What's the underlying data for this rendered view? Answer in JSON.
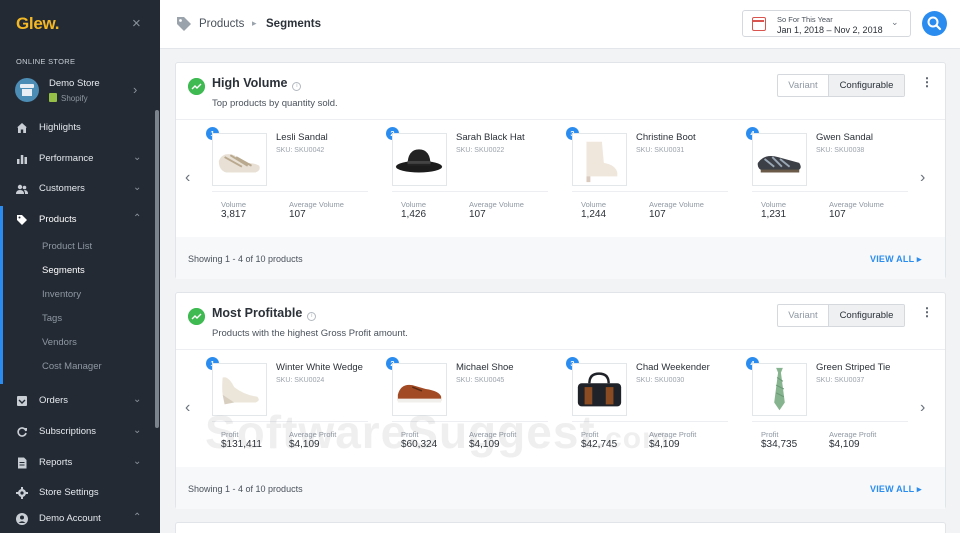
{
  "sidebar": {
    "logo": "Glew.",
    "close": "×",
    "section_label": "ONLINE STORE",
    "store": {
      "name": "Demo Store",
      "platform": "Shopify"
    },
    "items": [
      {
        "label": "Highlights",
        "icon": "home-icon"
      },
      {
        "label": "Performance",
        "icon": "bar-chart-icon"
      },
      {
        "label": "Customers",
        "icon": "users-icon"
      },
      {
        "label": "Products",
        "icon": "tag-icon"
      },
      {
        "label": "Orders",
        "icon": "inbox-icon"
      },
      {
        "label": "Subscriptions",
        "icon": "refresh-icon"
      },
      {
        "label": "Reports",
        "icon": "document-icon"
      },
      {
        "label": "Store Settings",
        "icon": "gear-icon"
      },
      {
        "label": "Demo Account",
        "icon": "user-icon"
      }
    ],
    "product_sub_items": [
      "Product List",
      "Segments",
      "Inventory",
      "Tags",
      "Vendors",
      "Cost Manager"
    ],
    "selected_sub_item": "Segments"
  },
  "topbar": {
    "breadcrumb": [
      "Products",
      "Segments"
    ],
    "date_range": {
      "label": "So For This Year",
      "value": "Jan 1, 2018 – Nov 2, 2018"
    }
  },
  "segments": [
    {
      "title": "High Volume",
      "description": "Top products by quantity sold.",
      "toggle": [
        "Variant",
        "Configurable"
      ],
      "active_toggle": "Configurable",
      "metric_labels": [
        "Volume",
        "Average Volume"
      ],
      "products": [
        {
          "rank": "1",
          "name": "Lesli Sandal",
          "sku": "SKU: SKU0042",
          "m1": "3,817",
          "m2": "107"
        },
        {
          "rank": "2",
          "name": "Sarah Black Hat",
          "sku": "SKU: SKU0022",
          "m1": "1,426",
          "m2": "107"
        },
        {
          "rank": "3",
          "name": "Christine Boot",
          "sku": "SKU: SKU0031",
          "m1": "1,244",
          "m2": "107"
        },
        {
          "rank": "4",
          "name": "Gwen Sandal",
          "sku": "SKU: SKU0038",
          "m1": "1,231",
          "m2": "107"
        }
      ],
      "footer": "Showing 1 - 4 of 10 products",
      "view_all": "VIEW ALL"
    },
    {
      "title": "Most Profitable",
      "description": "Products with the highest Gross Profit amount.",
      "toggle": [
        "Variant",
        "Configurable"
      ],
      "active_toggle": "Configurable",
      "metric_labels": [
        "Profit",
        "Average Profit"
      ],
      "products": [
        {
          "rank": "1",
          "name": "Winter White Wedge",
          "sku": "SKU: SKU0024",
          "m1": "$131,411",
          "m2": "$4,109"
        },
        {
          "rank": "2",
          "name": "Michael Shoe",
          "sku": "SKU: SKU0045",
          "m1": "$60,324",
          "m2": "$4,109"
        },
        {
          "rank": "3",
          "name": "Chad Weekender",
          "sku": "SKU: SKU0030",
          "m1": "$42,745",
          "m2": "$4,109"
        },
        {
          "rank": "4",
          "name": "Green Striped Tie",
          "sku": "SKU: SKU0037",
          "m1": "$34,735",
          "m2": "$4,109"
        }
      ],
      "footer": "Showing 1 - 4 of 10 products",
      "view_all": "VIEW ALL"
    }
  ],
  "watermark": {
    "main": "SoftwareSuggest",
    "suffix": ".com"
  },
  "colors": {
    "accent": "#2b8cf0",
    "sidebar": "#232a34",
    "logo": "#f3b823",
    "trend": "#3fba52"
  }
}
